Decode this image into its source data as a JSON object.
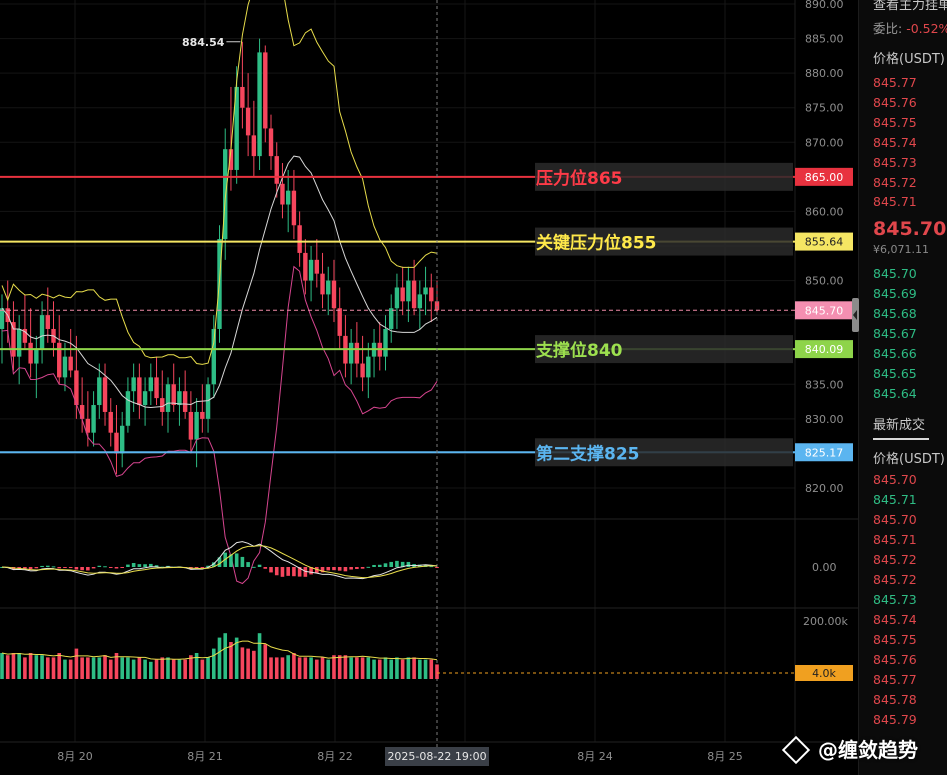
{
  "chart_data": {
    "type": "candlestick",
    "price_axis": {
      "ticks": [
        "890.00",
        "885.00",
        "880.00",
        "875.00",
        "870.00",
        "865.00",
        "860.00",
        "855.00",
        "850.00",
        "845.00",
        "840.00",
        "835.00",
        "830.00",
        "825.00",
        "820.00"
      ],
      "range": [
        817,
        891
      ]
    },
    "x_axis": {
      "ticks": [
        "8月 20",
        "8月 21",
        "8月 22",
        "8月 24",
        "8月 25"
      ],
      "crosshair_label": "2025-08-22 19:00"
    },
    "peak_label": "884.54",
    "levels": [
      {
        "name": "压力位865",
        "price": 865.0,
        "tag": "865.00",
        "color": "#e8323f",
        "text_color": "#ff3b48"
      },
      {
        "name": "关键压力位855",
        "price": 855.64,
        "tag": "855.64",
        "color": "#f5e663",
        "text_color": "#ffe94a"
      },
      {
        "name": "支撑位840",
        "price": 840.09,
        "tag": "840.09",
        "color": "#8ed44a",
        "text_color": "#9de04f"
      },
      {
        "name": "第二支撑825",
        "price": 825.17,
        "tag": "825.17",
        "color": "#5bb5f0",
        "text_color": "#5bb5f0"
      }
    ],
    "last_price": {
      "value": 845.7,
      "tag": "845.70"
    },
    "macd_zero_label": "0.00",
    "volume_axis_label": "200.00k",
    "volume_last_tag": "4.0k",
    "candles": [
      [
        843,
        848,
        838,
        846
      ],
      [
        846,
        850,
        841,
        844
      ],
      [
        844,
        847,
        837,
        839
      ],
      [
        839,
        845,
        835,
        843
      ],
      [
        843,
        848,
        840,
        841
      ],
      [
        841,
        846,
        836,
        838
      ],
      [
        838,
        842,
        833,
        840
      ],
      [
        840,
        847,
        838,
        845
      ],
      [
        845,
        849,
        841,
        843
      ],
      [
        843,
        847,
        839,
        841
      ],
      [
        841,
        845,
        835,
        836
      ],
      [
        836,
        841,
        834,
        839
      ],
      [
        839,
        843,
        836,
        837
      ],
      [
        837,
        842,
        830,
        832
      ],
      [
        832,
        836,
        828,
        830
      ],
      [
        830,
        834,
        826,
        828
      ],
      [
        828,
        834,
        826,
        832
      ],
      [
        832,
        838,
        830,
        836
      ],
      [
        836,
        838,
        829,
        831
      ],
      [
        831,
        833,
        826,
        828
      ],
      [
        828,
        832,
        822,
        825
      ],
      [
        825,
        831,
        823,
        829
      ],
      [
        829,
        836,
        828,
        834
      ],
      [
        834,
        838,
        831,
        836
      ],
      [
        836,
        838,
        830,
        832
      ],
      [
        832,
        836,
        829,
        834
      ],
      [
        834,
        838,
        832,
        836
      ],
      [
        836,
        839,
        832,
        833
      ],
      [
        833,
        837,
        829,
        831
      ],
      [
        831,
        836,
        828,
        835
      ],
      [
        835,
        838,
        831,
        832
      ],
      [
        832,
        836,
        829,
        834
      ],
      [
        834,
        837,
        830,
        831
      ],
      [
        831,
        834,
        825,
        827
      ],
      [
        827,
        833,
        823,
        831
      ],
      [
        831,
        835,
        828,
        830
      ],
      [
        830,
        836,
        828,
        835
      ],
      [
        835,
        845,
        833,
        843
      ],
      [
        843,
        858,
        841,
        856
      ],
      [
        856,
        872,
        853,
        869
      ],
      [
        869,
        878,
        863,
        866
      ],
      [
        866,
        881,
        864,
        878
      ],
      [
        878,
        884.54,
        872,
        875
      ],
      [
        875,
        880,
        868,
        871
      ],
      [
        871,
        876,
        865,
        868
      ],
      [
        868,
        885,
        866,
        883
      ],
      [
        883,
        884,
        870,
        872
      ],
      [
        872,
        874,
        866,
        868
      ],
      [
        868,
        870,
        862,
        864
      ],
      [
        864,
        867,
        859,
        861
      ],
      [
        861,
        866,
        857,
        863
      ],
      [
        863,
        866,
        856,
        858
      ],
      [
        858,
        860,
        852,
        854
      ],
      [
        854,
        856,
        848,
        850
      ],
      [
        850,
        855,
        847,
        853
      ],
      [
        853,
        856,
        849,
        851
      ],
      [
        851,
        854,
        846,
        848
      ],
      [
        848,
        852,
        845,
        850
      ],
      [
        850,
        853,
        844,
        846
      ],
      [
        846,
        849,
        840,
        842
      ],
      [
        842,
        845,
        836,
        838
      ],
      [
        838,
        843,
        835,
        841
      ],
      [
        841,
        844,
        836,
        838
      ],
      [
        838,
        842,
        834,
        836
      ],
      [
        836,
        841,
        833,
        839
      ],
      [
        839,
        843,
        836,
        841
      ],
      [
        841,
        844,
        837,
        839
      ],
      [
        839,
        845,
        837,
        843
      ],
      [
        843,
        848,
        841,
        846
      ],
      [
        846,
        851,
        843,
        849
      ],
      [
        849,
        852,
        845,
        847
      ],
      [
        847,
        852,
        844,
        850
      ],
      [
        850,
        853,
        845,
        846
      ],
      [
        846,
        850,
        843,
        848
      ],
      [
        848,
        852,
        845,
        849
      ],
      [
        849,
        851,
        844,
        847
      ],
      [
        847,
        850,
        845.2,
        845.7
      ]
    ]
  }
}
